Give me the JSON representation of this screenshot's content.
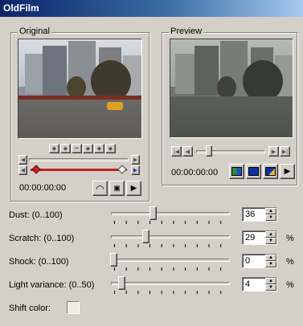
{
  "window": {
    "title": "OldFilm"
  },
  "original": {
    "label": "Original",
    "timecode": "00:00:00:00"
  },
  "preview": {
    "label": "Preview",
    "timecode": "00:00:00:00"
  },
  "params": [
    {
      "id": "dust",
      "label": "Dust: (0..100)",
      "value": "36",
      "show_percent": false,
      "level": 0.36
    },
    {
      "id": "scratch",
      "label": "Scratch: (0..100)",
      "value": "29",
      "show_percent": true,
      "level": 0.29
    },
    {
      "id": "shock",
      "label": "Shock: (0..100)",
      "value": "0",
      "show_percent": true,
      "level": 0.0
    },
    {
      "id": "light",
      "label": "Light variance: (0..50)",
      "value": "4",
      "show_percent": true,
      "level": 0.08
    }
  ],
  "percent_sign": "%",
  "shift_color": {
    "label": "Shift color:"
  },
  "colors": {
    "face": "#d4d0c8",
    "title_start": "#0a246a",
    "title_end": "#a6caf0"
  }
}
